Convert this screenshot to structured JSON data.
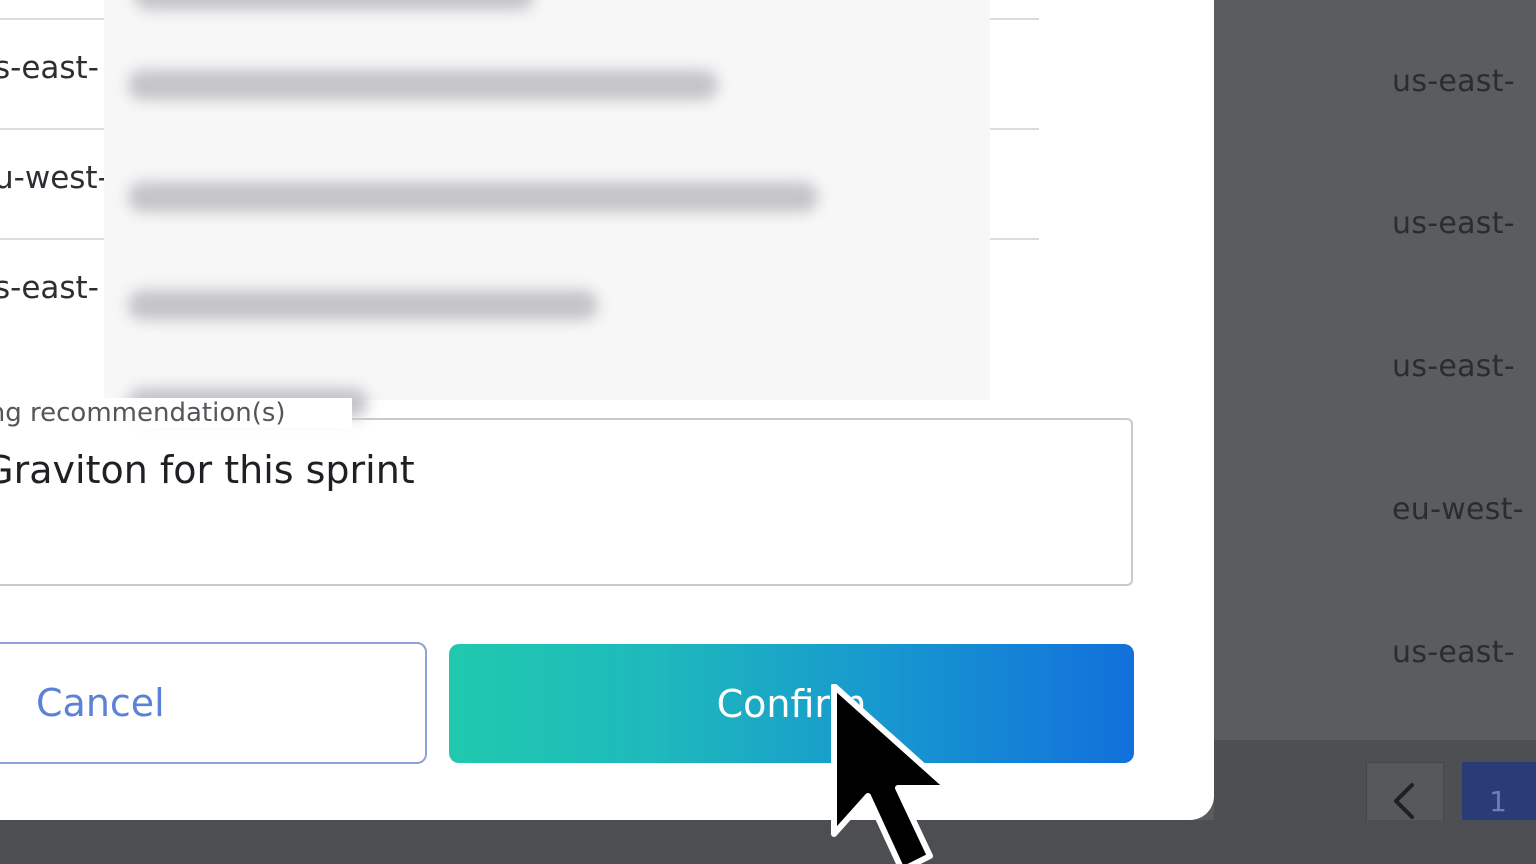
{
  "background": {
    "regions": [
      "us-east-",
      "us-east-",
      "us-east-",
      "eu-west-",
      "us-east-"
    ],
    "pagination": {
      "prev_icon": "chevron-left-icon",
      "current_page": "1"
    }
  },
  "modal": {
    "rows": [
      {
        "region": "s-east-"
      },
      {
        "region": "u-west-"
      },
      {
        "region": "s-east-"
      }
    ],
    "reason_field": {
      "label": "ozing recommendation(s)",
      "value": "n Graviton for this sprint"
    },
    "buttons": {
      "cancel": "Cancel",
      "confirm": "Confirm"
    }
  },
  "colors": {
    "overlay": "#5b5c60",
    "confirm_gradient_start": "#20c9ae",
    "confirm_gradient_end": "#1270dc",
    "cancel_text": "#5b82d6",
    "pagination_active": "#2a3c78"
  }
}
